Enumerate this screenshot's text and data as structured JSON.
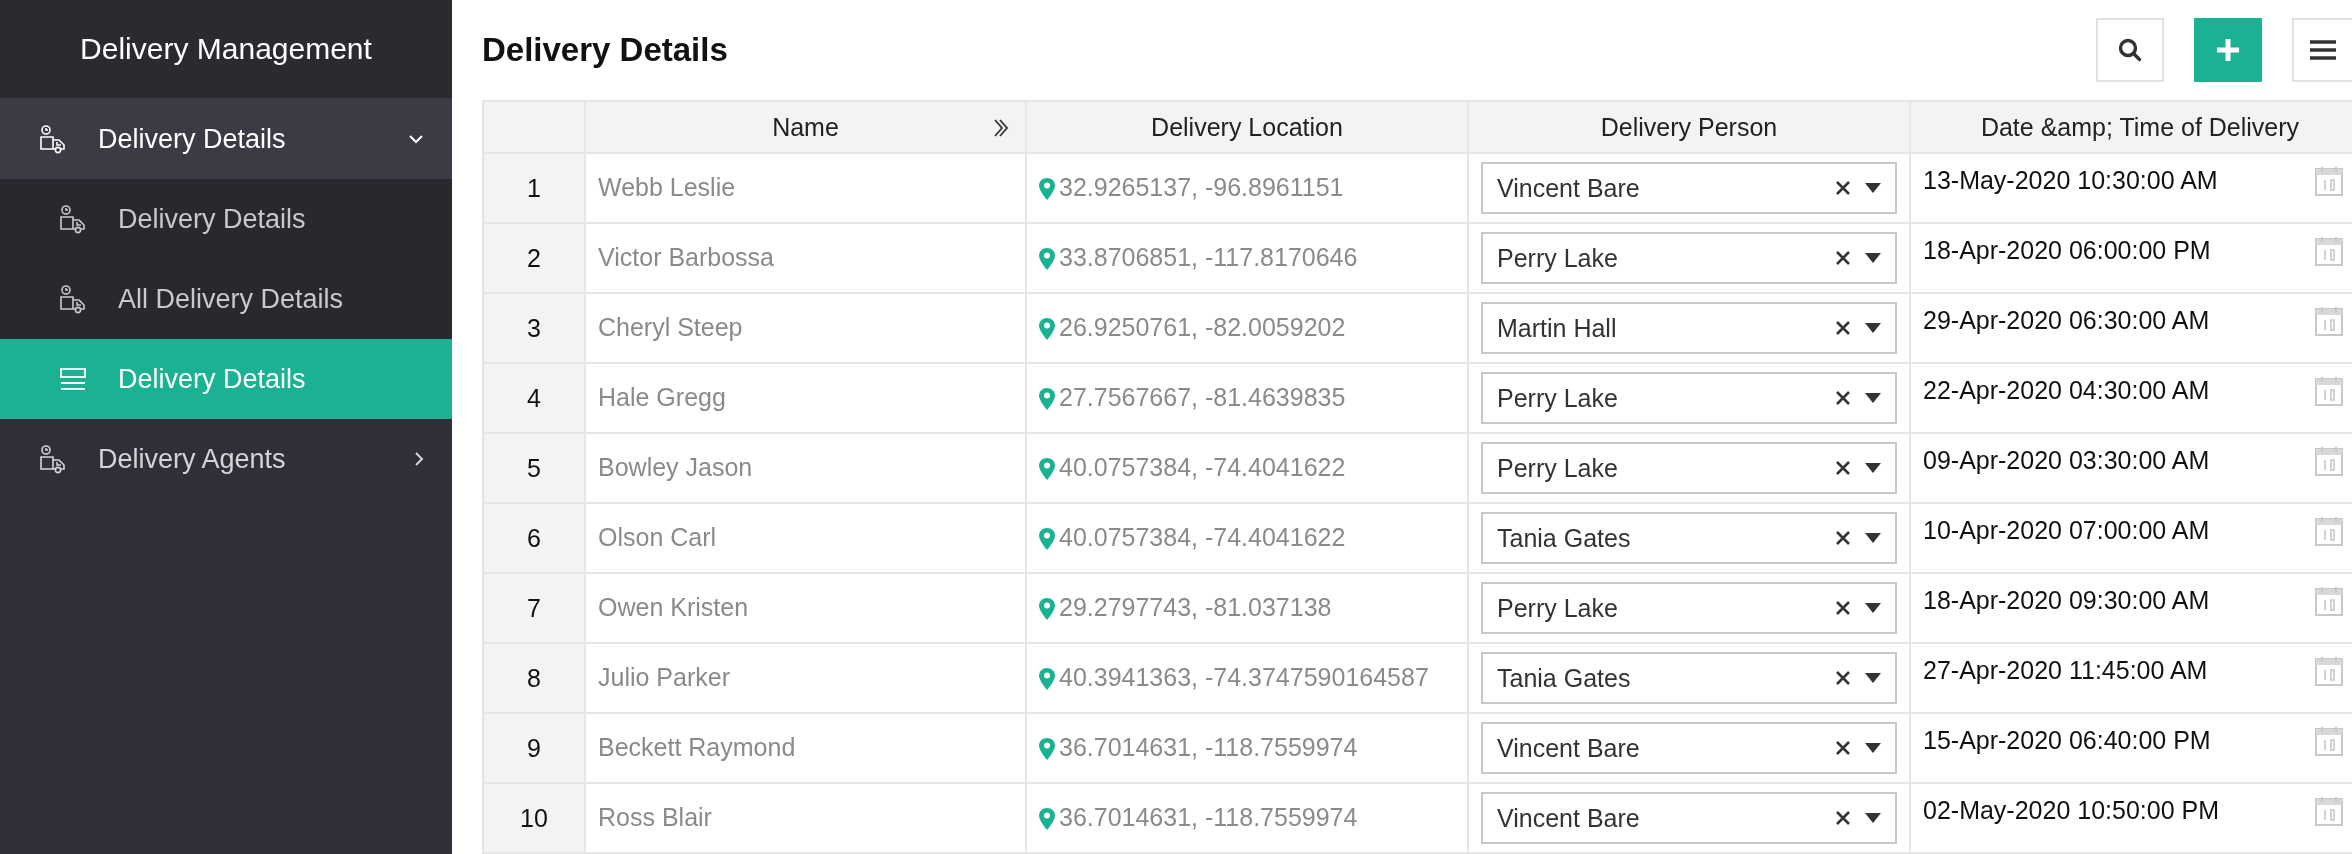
{
  "sidebar": {
    "title": "Delivery Management",
    "items": [
      {
        "label": "Delivery Details",
        "kind": "form",
        "selected": false,
        "expanded": true,
        "children": [
          {
            "label": "Delivery Details",
            "kind": "form",
            "selected": false
          },
          {
            "label": "All Delivery Details",
            "kind": "form",
            "selected": false
          },
          {
            "label": "Delivery Details",
            "kind": "report",
            "selected": true
          }
        ]
      },
      {
        "label": "Delivery Agents",
        "kind": "form",
        "selected": false,
        "expanded": false
      }
    ]
  },
  "page": {
    "title": "Delivery Details"
  },
  "table": {
    "columns": [
      {
        "label": "Name"
      },
      {
        "label": "Delivery Location"
      },
      {
        "label": "Delivery Person"
      },
      {
        "label": "Date &amp; Time of Delivery"
      }
    ],
    "rows": [
      {
        "index": "1",
        "name": "Webb Leslie",
        "location": "32.9265137, -96.8961151",
        "person": "Vincent Bare",
        "date": "13-May-2020 10:30:00 AM"
      },
      {
        "index": "2",
        "name": "Victor Barbossa",
        "location": "33.8706851, -117.8170646",
        "person": "Perry Lake",
        "date": "18-Apr-2020 06:00:00 PM"
      },
      {
        "index": "3",
        "name": "Cheryl Steep",
        "location": "26.9250761, -82.0059202",
        "person": "Martin Hall",
        "date": "29-Apr-2020 06:30:00 AM"
      },
      {
        "index": "4",
        "name": "Hale Gregg",
        "location": "27.7567667, -81.4639835",
        "person": "Perry Lake",
        "date": "22-Apr-2020 04:30:00 AM"
      },
      {
        "index": "5",
        "name": "Bowley Jason",
        "location": "40.0757384, -74.4041622",
        "person": "Perry Lake",
        "date": "09-Apr-2020 03:30:00 AM"
      },
      {
        "index": "6",
        "name": "Olson Carl",
        "location": "40.0757384, -74.4041622",
        "person": "Tania Gates",
        "date": "10-Apr-2020 07:00:00 AM"
      },
      {
        "index": "7",
        "name": "Owen Kristen",
        "location": "29.2797743, -81.037138",
        "person": "Perry Lake",
        "date": "18-Apr-2020 09:30:00 AM"
      },
      {
        "index": "8",
        "name": "Julio Parker",
        "location": "40.3941363, -74.3747590164587",
        "person": "Tania Gates",
        "date": "27-Apr-2020 11:45:00 AM"
      },
      {
        "index": "9",
        "name": "Beckett Raymond",
        "location": "36.7014631, -118.7559974",
        "person": "Vincent Bare",
        "date": "15-Apr-2020 06:40:00 PM"
      },
      {
        "index": "10",
        "name": "Ross Blair",
        "location": "36.7014631, -118.7559974",
        "person": "Vincent Bare",
        "date": "02-May-2020 10:50:00 PM"
      }
    ]
  }
}
